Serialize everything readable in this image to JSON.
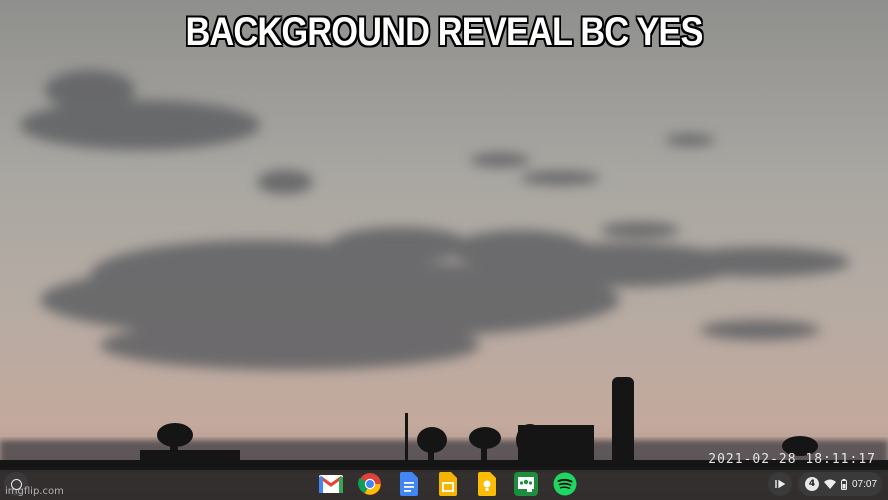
{
  "meme": {
    "caption": "BACKGROUND REVEAL BC YES",
    "camera_timestamp": "2021-02-28  18:11:17",
    "watermark": "imgflip.com"
  },
  "shelf": {
    "apps": [
      {
        "name": "gmail-icon"
      },
      {
        "name": "chrome-icon"
      },
      {
        "name": "google-docs-icon"
      },
      {
        "name": "google-slides-icon"
      },
      {
        "name": "google-keep-icon"
      },
      {
        "name": "google-classroom-icon"
      },
      {
        "name": "spotify-icon"
      }
    ],
    "tray": {
      "notification_count": "4",
      "time": "07:07"
    }
  },
  "colors": {
    "shelf": "#1a1a1a",
    "sky_top": "#9a9a97",
    "sky_horizon": "#c2a89c"
  }
}
